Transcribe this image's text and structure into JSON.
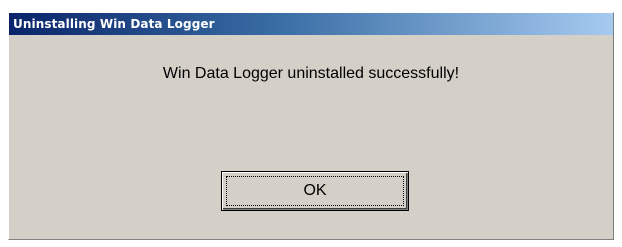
{
  "dialog": {
    "title": "Uninstalling Win Data Logger",
    "message": "Win Data Logger uninstalled successfully!",
    "ok_label": "OK"
  },
  "colors": {
    "titlebar_start": "#0a246a",
    "titlebar_end": "#a6caf0",
    "face": "#d4d0c8"
  }
}
